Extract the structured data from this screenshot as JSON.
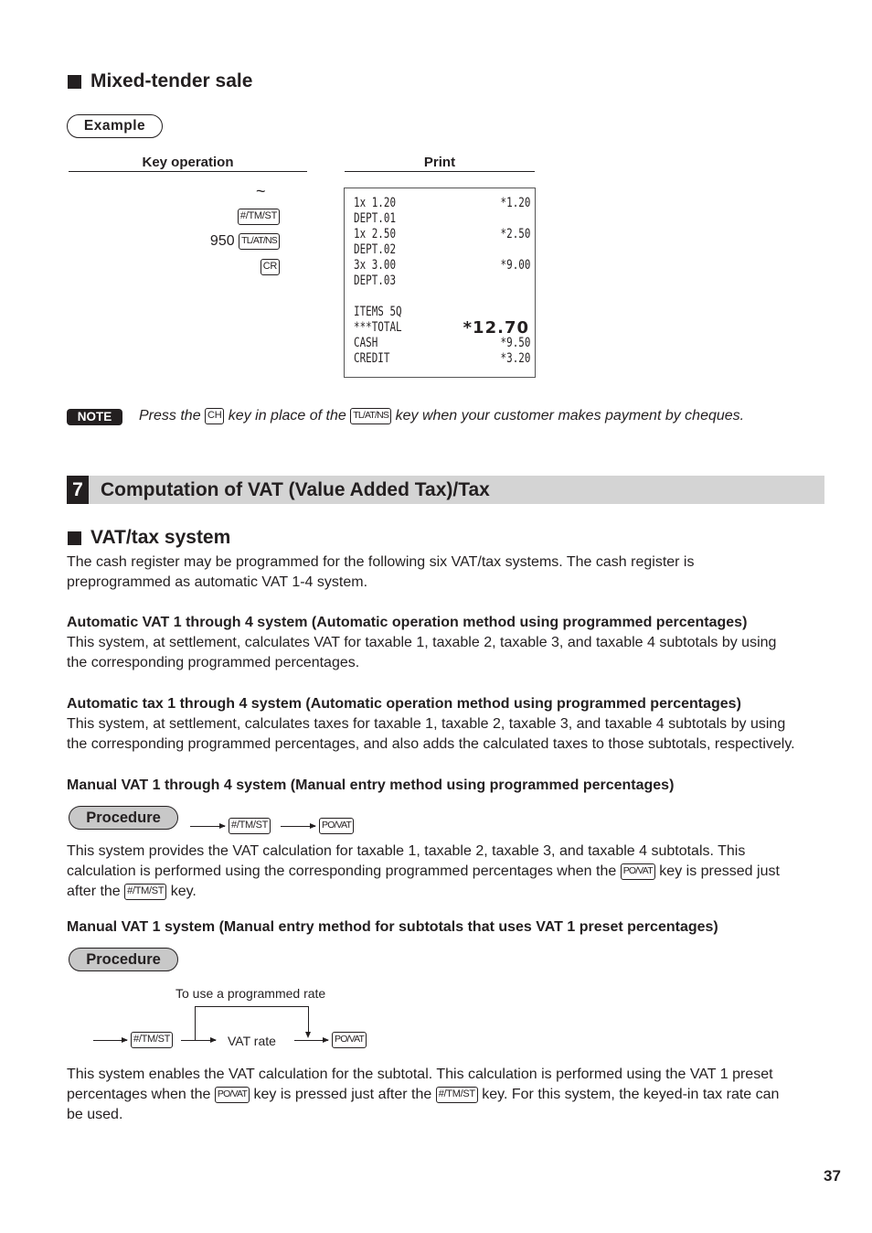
{
  "mixed_tender": {
    "heading": "Mixed-tender sale",
    "example_label": "Example",
    "key_operation_header": "Key operation",
    "print_header": "Print",
    "key_ops": [
      {
        "prefix": "",
        "key": "~"
      },
      {
        "prefix": "",
        "key": "#/TM/ST"
      },
      {
        "prefix": "950",
        "key": "TL/AT/NS"
      },
      {
        "prefix": "",
        "key": "CR"
      }
    ],
    "receipt": [
      {
        "left": "1x 1.20",
        "right": "*1.20"
      },
      {
        "left": "DEPT.01",
        "right": ""
      },
      {
        "left": "1x 2.50",
        "right": "*2.50"
      },
      {
        "left": "DEPT.02",
        "right": ""
      },
      {
        "left": "3x 3.00",
        "right": "*9.00"
      },
      {
        "left": "DEPT.03",
        "right": ""
      },
      {
        "left": "",
        "right": ""
      },
      {
        "left": "ITEMS 5Q",
        "right": ""
      },
      {
        "left": "***TOTAL",
        "right": "*12.70"
      },
      {
        "left": "CASH",
        "right": "*9.50"
      },
      {
        "left": "CREDIT",
        "right": "*3.20"
      }
    ]
  },
  "note": {
    "badge": "NOTE",
    "part1": "Press the",
    "key1": "CH",
    "part2": "key in place of the",
    "key2": "TL/AT/NS",
    "part3": "key when your customer makes payment by cheques."
  },
  "section": {
    "number": "7",
    "title": "Computation of VAT (Value Added Tax)/Tax"
  },
  "vat_system": {
    "heading": "VAT/tax system",
    "intro_line1": "The cash register may be programmed for the following six VAT/tax systems. The cash register is",
    "intro_line2": "preprogrammed as automatic VAT 1-4 system.",
    "auto_vat": {
      "title": "Automatic VAT 1 through 4 system (Automatic operation method using programmed percentages)",
      "line1": "This system, at settlement, calculates VAT for taxable 1, taxable 2, taxable 3, and taxable 4 subtotals by using",
      "line2": "the corresponding programmed percentages."
    },
    "auto_tax": {
      "title": "Automatic tax 1 through 4 system (Automatic operation method using programmed percentages)",
      "line1": "This system, at settlement, calculates taxes for taxable 1, taxable 2, taxable 3, and taxable 4 subtotals by using",
      "line2": "the corresponding programmed percentages, and also adds the calculated taxes to those subtotals, respectively."
    },
    "manual_vat14": {
      "title": "Manual VAT 1 through 4 system (Manual entry method using programmed percentages)",
      "procedure_label": "Procedure",
      "key_a": "#/TM/ST",
      "key_b": "PO/VAT",
      "line1": "This system provides the VAT calculation for taxable 1, taxable 2, taxable 3, and taxable 4 subtotals. This",
      "line2a": "calculation is performed using the corresponding programmed percentages when the",
      "line2_key": "PO/VAT",
      "line2b": "key is pressed just",
      "line3a": "after the",
      "line3_key": "#/TM/ST",
      "line3b": "key."
    },
    "manual_vat1": {
      "title": "Manual VAT 1 system (Manual entry method for subtotals that uses VAT 1 preset percentages)",
      "procedure_label": "Procedure",
      "bypass_label": "To use a programmed rate",
      "key_a": "#/TM/ST",
      "middle_label": "VAT rate",
      "key_b": "PO/VAT",
      "line1": "This system enables the VAT calculation for the subtotal. This calculation is performed using the VAT 1 preset",
      "line2a": "percentages when the",
      "line2_key1": "PO/VAT",
      "line2b": "key is pressed just after the",
      "line2_key2": "#/TM/ST",
      "line2c": "key. For this system, the keyed-in tax rate can",
      "line3": "be used."
    }
  },
  "page_number": "37"
}
